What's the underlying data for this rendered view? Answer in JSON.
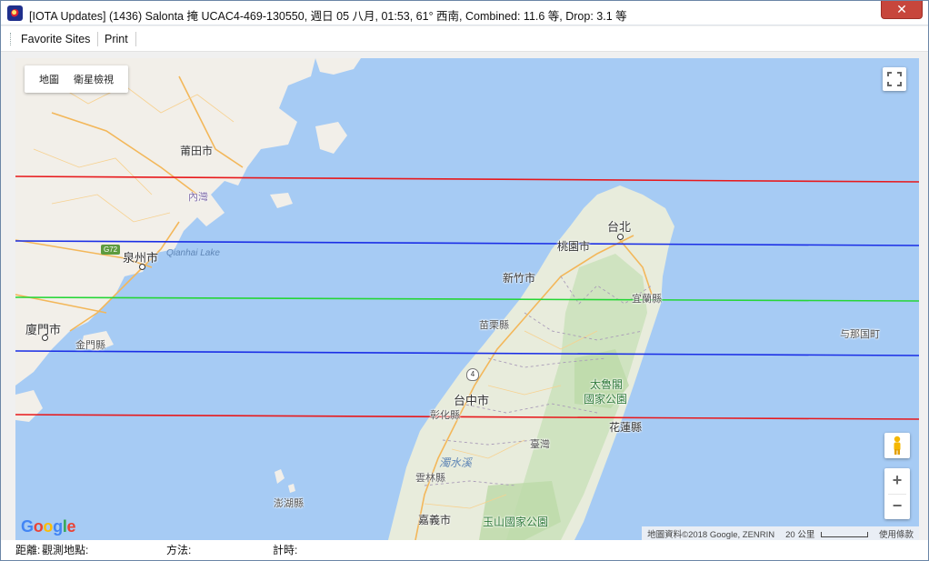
{
  "window": {
    "title": "[IOTA Updates] (1436) Salonta 掩 UCAC4-469-130550, 週日 05 八月, 01:53, 61° 西南, Combined: 11.6 等, Drop:  3.1 等",
    "close_label": "✕"
  },
  "menu": {
    "favorite_sites": "Favorite Sites",
    "print": "Print"
  },
  "map": {
    "type_control": {
      "map": "地圖",
      "satellite": "衛星檢視"
    },
    "labels": {
      "putian": "莆田市",
      "quanzhou": "泉州市",
      "qianhai_lake": "Qianhai Lake",
      "xiamen": "廈門市",
      "jinmen": "金門縣",
      "neiwu": "內灣",
      "taipei": "台北",
      "taoyuan": "桃園市",
      "hsinchu": "新竹市",
      "yilan": "宜蘭縣",
      "miaoli": "苗栗縣",
      "taichung": "台中市",
      "changhua": "彰化縣",
      "taroko": "太魯閣",
      "taroko_park": "國家公園",
      "hualien": "花蓮縣",
      "taiwan": "臺灣",
      "yunlin": "雲林縣",
      "zhuoshui": "濁水溪",
      "penghu": "澎湖縣",
      "chiayi": "嘉義市",
      "yushan": "玉山國家公園",
      "yonaguni": "与那国町",
      "g72": "G72",
      "road4": "4"
    },
    "zoom_in": "+",
    "zoom_out": "−",
    "attribution": {
      "data": "地圖資料©2018 Google, ZENRIN",
      "scale": "20 公里",
      "terms": "使用條款"
    },
    "path_lines": {
      "outer_limit_color": "#e8191c",
      "shadow_edge_color": "#1a2ee6",
      "center_line_color": "#25d636"
    }
  },
  "status": {
    "distance": "距離:",
    "observer_site": "觀測地點:",
    "method": "方法:",
    "timing": "計時:"
  }
}
